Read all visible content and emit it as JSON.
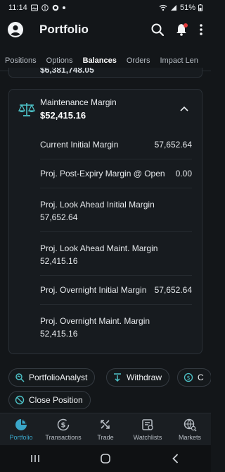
{
  "status_bar": {
    "time": "11:14",
    "battery": "51%"
  },
  "header": {
    "title": "Portfolio"
  },
  "tabs": [
    {
      "label": "Positions",
      "active": false
    },
    {
      "label": "Options",
      "active": false
    },
    {
      "label": "Balances",
      "active": true
    },
    {
      "label": "Orders",
      "active": false
    },
    {
      "label": "Impact Len",
      "active": false
    }
  ],
  "previous_card": {
    "partial_value": "$6,381,748.05"
  },
  "margin_card": {
    "title": "Maintenance Margin",
    "value": "$52,415.16",
    "rows": [
      {
        "label": "Current Initial Margin",
        "value": "57,652.64",
        "layout": "single"
      },
      {
        "label": "Proj. Post-Expiry Margin @ Open",
        "value": "0.00",
        "layout": "single"
      },
      {
        "label": "Proj. Look Ahead Initial Margin",
        "value": "57,652.64",
        "layout": "double"
      },
      {
        "label": "Proj. Look Ahead Maint. Margin",
        "value": "52,415.16",
        "layout": "double"
      },
      {
        "label": "Proj. Overnight Initial Margin",
        "value": "57,652.64",
        "layout": "single"
      },
      {
        "label": "Proj. Overnight Maint. Margin",
        "value": "52,415.16",
        "layout": "double"
      }
    ]
  },
  "actions": {
    "portfolio_analyst": "PortfolioAnalyst",
    "withdraw": "Withdraw",
    "convert_partial": "C",
    "close_position": "Close Position"
  },
  "bottom_nav": [
    {
      "label": "Portfolio",
      "icon": "pie-chart-icon",
      "active": true
    },
    {
      "label": "Transactions",
      "icon": "dollar-cycle-icon",
      "active": false
    },
    {
      "label": "Trade",
      "icon": "trade-arrows-icon",
      "active": false
    },
    {
      "label": "Watchlists",
      "icon": "watchlist-icon",
      "active": false
    },
    {
      "label": "Markets",
      "icon": "globe-search-icon",
      "active": false
    }
  ],
  "colors": {
    "background": "#131619",
    "card": "#171b1f",
    "accent": "#3aa6c9",
    "icon_teal": "#4ec3c8",
    "notification": "#e33b3b"
  }
}
